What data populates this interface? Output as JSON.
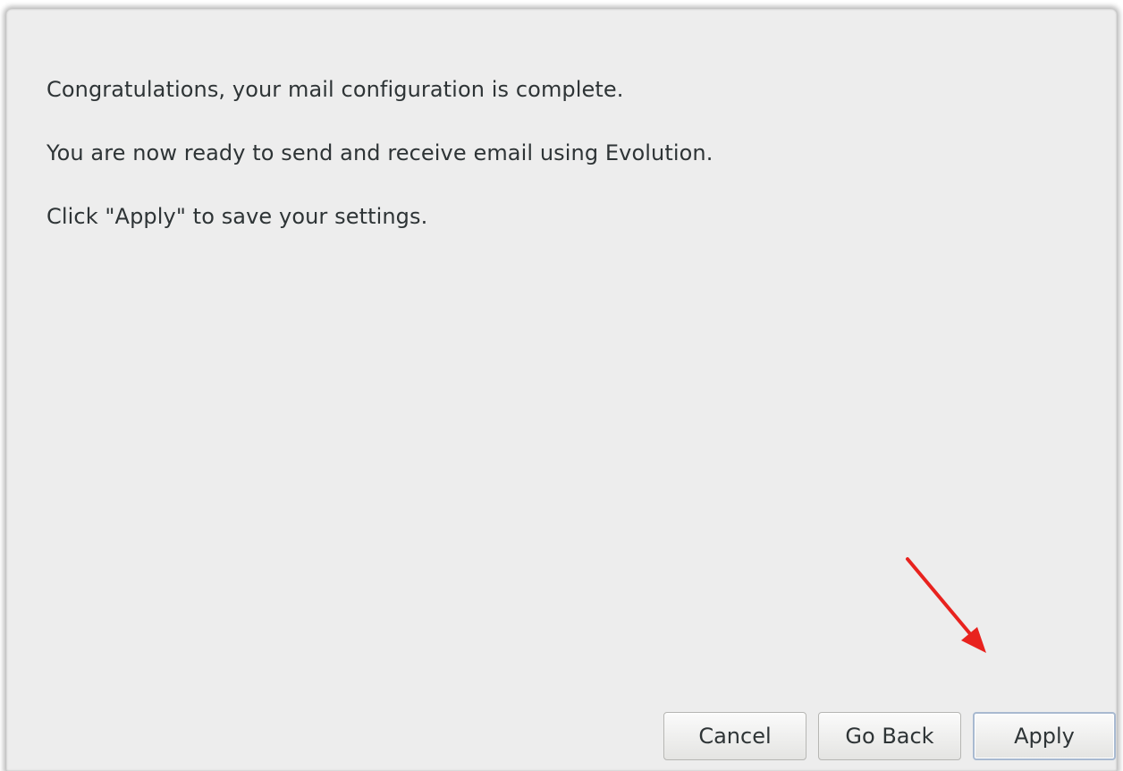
{
  "dialog": {
    "messages": [
      "Congratulations, your mail configuration is complete.",
      "You are now ready to send and receive email using Evolution.",
      "Click \"Apply\" to save your settings."
    ]
  },
  "buttons": {
    "cancel": "Cancel",
    "go_back": "Go Back",
    "apply": "Apply"
  },
  "annotation": {
    "arrow_color": "#e8221e",
    "points_to": "apply-button"
  }
}
